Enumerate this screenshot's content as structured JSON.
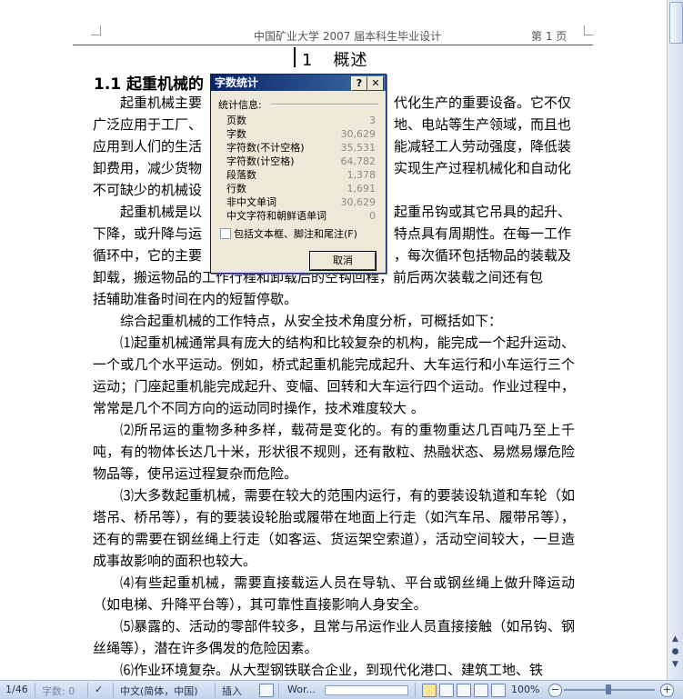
{
  "header": {
    "center": "中国矿业大学 2007 届本科生毕业设计",
    "right": "第 1 页"
  },
  "chapter": {
    "number": "1",
    "title": "概述"
  },
  "section": {
    "title_visible": "1.1 起重机械的"
  },
  "paragraphs": {
    "p1": [
      "起重机械主要",
      "代化生产的重要设备。它不仅",
      "广泛应用于工厂、",
      "地、电站等生产领域，而且也",
      "应用到人们的生活",
      "能减轻工人劳动强度，降低装",
      "卸费用，减少货物",
      "实现生产过程机械化和自动化",
      "不可缺少的机械设"
    ],
    "p2": [
      "起重机械是以",
      "起重吊钩或其它吊具的起升、",
      "下降，或升降与运",
      "特点具有周期性。在每一工作",
      "循环中，它的主要",
      "，每次循环包括物品的装载及",
      "卸载，搬运物品的工作行程和卸载后的空钩回程，前后两次装载之间还有包",
      "括辅助准备时间在内的短暂停歇。"
    ],
    "p3": "综合起重机械的工作特点，从安全技术角度分析，可概括如下：",
    "p4": "⑴起重机械通常具有庞大的结构和比较复杂的机构，能完成一个起升运动、一个或几个水平运动。例如，桥式起重机能完成起升、大车运行和小车运行三个运动；门座起重机能完成起升、变幅、回转和大车运行四个运动。作业过程中，常常是几个不同方向的运动同时操作，技术难度较大 。",
    "p5": "⑵所吊运的重物多种多样，载荷是变化的。有的重物重达几百吨乃至上千吨，有的物体长达几十米，形状很不规则，还有散粒、热融状态、易燃易爆危险物品等，使吊运过程复杂而危险。",
    "p6": "⑶大多数起重机械，需要在较大的范围内运行，有的要装设轨道和车轮（如塔吊、桥吊等），有的要装设轮胎或履带在地面上行走（如汽车吊、履带吊等），还有的需要在钢丝绳上行走（如客运、货运架空索道），活动空间较大，一旦造成事故影响的面积也较大。",
    "p7": "⑷有些起重机械，需要直接载运人员在导轨、平台或钢丝绳上做升降运动（如电梯、升降平台等），其可靠性直接影响人身安全。",
    "p8": "⑸暴露的、活动的零部件较多，且常与吊运作业人员直接接触（如吊钩、钢丝绳等），潜在许多偶发的危险因素。",
    "p9": "⑹作业环境复杂。从大型钢铁联合企业，到现代化港口、建筑工地、铁"
  },
  "dialog": {
    "title": "字数统计",
    "help": "?",
    "close": "✕",
    "group_label": "统计信息:",
    "rows": [
      {
        "label": "页数",
        "value": "3"
      },
      {
        "label": "字数",
        "value": "30,629"
      },
      {
        "label": "字符数(不计空格)",
        "value": "35,531"
      },
      {
        "label": "字符数(计空格)",
        "value": "64,782"
      },
      {
        "label": "段落数",
        "value": "1,378"
      },
      {
        "label": "行数",
        "value": "1,691"
      },
      {
        "label": "非中文单词",
        "value": "30,629"
      },
      {
        "label": "中文字符和朝鲜语单词",
        "value": "0"
      }
    ],
    "checkbox_label": "包括文本框、脚注和尾注(F)",
    "cancel": "取消"
  },
  "statusbar": {
    "page": "1/46",
    "wordcount": "字数: 0",
    "language": "中文(简体，中国)",
    "insert": "插入",
    "task": "Wor...",
    "zoom": "100%",
    "minus": "−",
    "plus": "+"
  },
  "icons": [
    "help-icon",
    "close-icon",
    "spelling-icon",
    "macro-icon",
    "print-layout-icon",
    "full-screen-icon",
    "web-layout-icon",
    "outline-icon",
    "draft-icon",
    "browse-object-icon"
  ]
}
